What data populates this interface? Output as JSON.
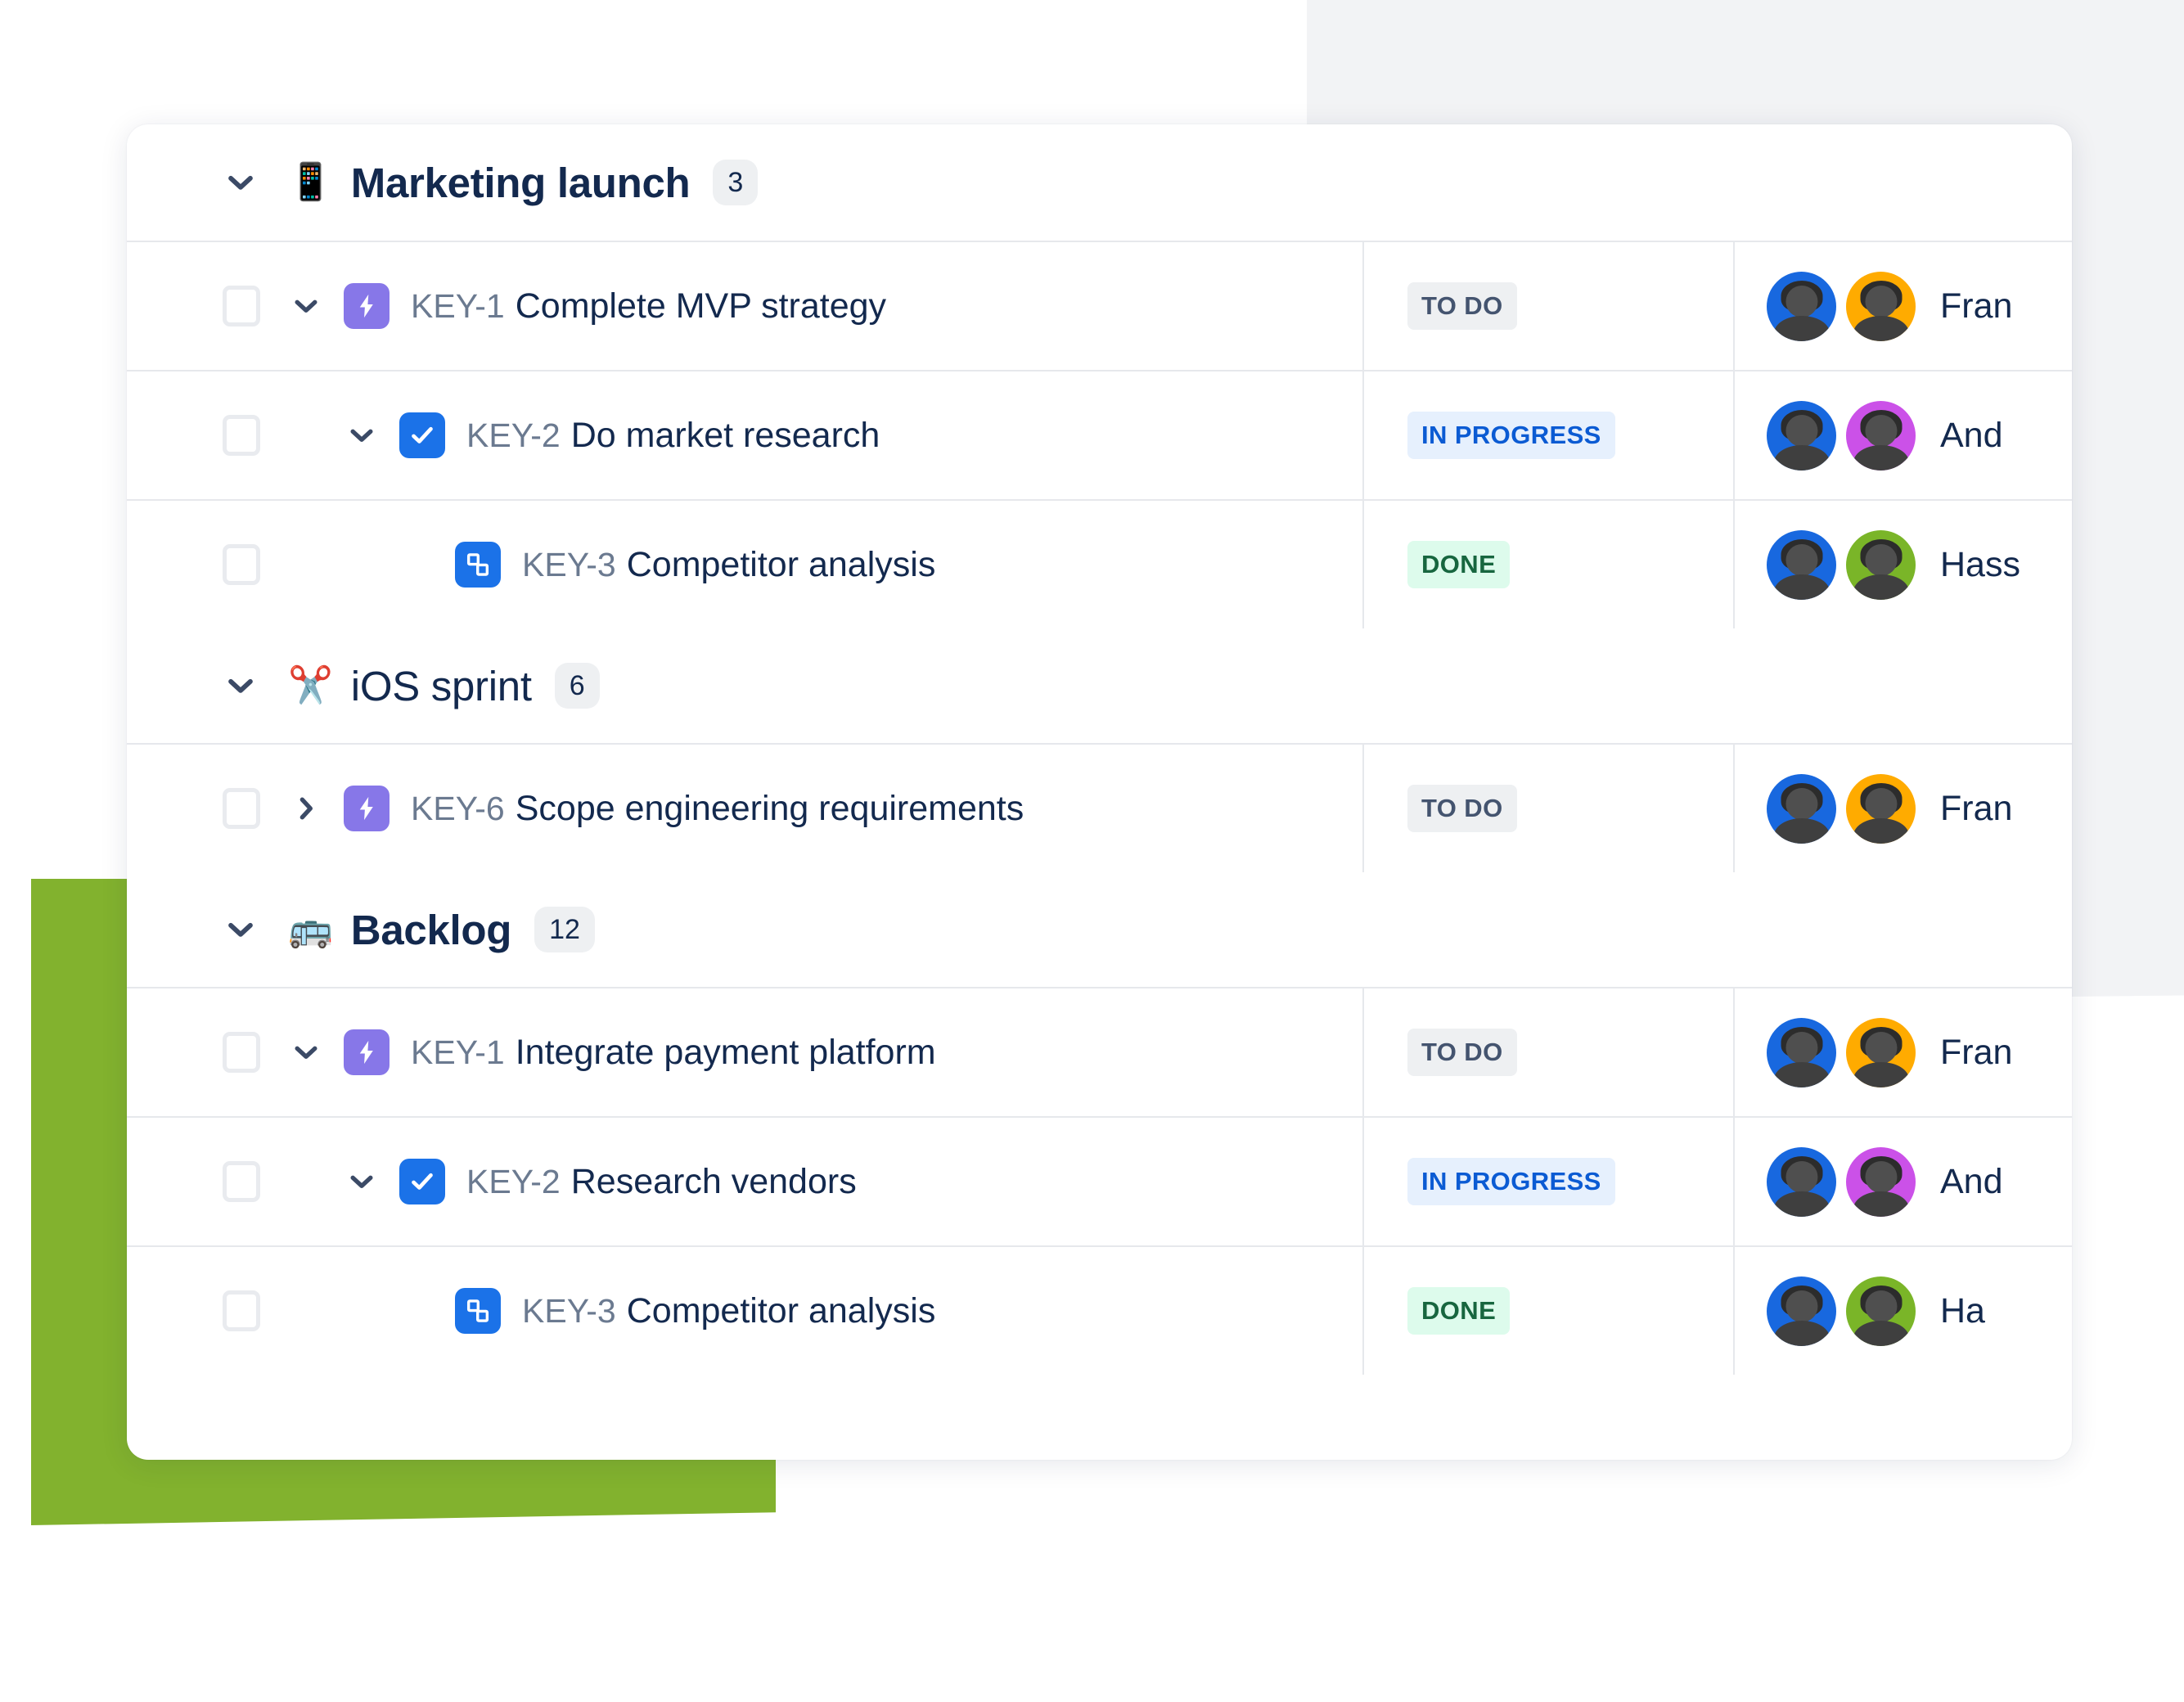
{
  "colors": {
    "green_block": "#82b22e",
    "gray_panel": "#f2f3f5",
    "epic_purple": "#8777e8",
    "task_blue": "#1b72e8",
    "text_navy": "#13294e",
    "key_gray": "#6b7a90",
    "todo_bg": "#eef0f2",
    "todo_fg": "#44546f",
    "inprogress_bg": "#e6f0fd",
    "inprogress_fg": "#0b5bd3",
    "done_bg": "#ddfbec",
    "done_fg": "#17663f"
  },
  "groups": [
    {
      "id": "marketing-launch",
      "emoji": "📱",
      "emoji_name": "mobile-phone-emoji",
      "title": "Marketing launch",
      "count": "3",
      "expanded": true,
      "chevron": "down",
      "bold": true,
      "rows": [
        {
          "indent": 1,
          "chevron": "down",
          "type": "epic",
          "type_icon_name": "epic-lightning-icon",
          "key": "KEY-1",
          "title": "Complete MVP strategy",
          "status": "TO DO",
          "status_kind": "todo",
          "assignee": "Fran",
          "avatars": [
            "#1868df",
            "#ffab00"
          ]
        },
        {
          "indent": 2,
          "chevron": "down",
          "type": "task",
          "type_icon_name": "task-checkmark-icon",
          "key": "KEY-2",
          "title": "Do market research",
          "status": "IN PROGRESS",
          "status_kind": "inprogress",
          "assignee": "And",
          "avatars": [
            "#1868df",
            "#cb51e8"
          ]
        },
        {
          "indent": 3,
          "chevron": "none",
          "type": "subtask",
          "type_icon_name": "subtask-blocks-icon",
          "key": "KEY-3",
          "title": "Competitor analysis",
          "status": "DONE",
          "status_kind": "done",
          "assignee": "Hass",
          "avatars": [
            "#1868df",
            "#7ab528"
          ]
        }
      ]
    },
    {
      "id": "ios-sprint",
      "emoji": "✂️",
      "emoji_name": "scissors-emoji",
      "title": "iOS sprint",
      "count": "6",
      "expanded": true,
      "chevron": "down",
      "bold": false,
      "rows": [
        {
          "indent": 1,
          "chevron": "right",
          "type": "epic",
          "type_icon_name": "epic-lightning-icon",
          "key": "KEY-6",
          "title": "Scope engineering requirements",
          "status": "TO DO",
          "status_kind": "todo",
          "assignee": "Fran",
          "avatars": [
            "#1868df",
            "#ffab00"
          ]
        }
      ]
    },
    {
      "id": "backlog",
      "emoji": "🚌",
      "emoji_name": "bus-emoji",
      "title": "Backlog",
      "count": "12",
      "expanded": true,
      "chevron": "down",
      "bold": true,
      "rows": [
        {
          "indent": 1,
          "chevron": "down",
          "type": "epic",
          "type_icon_name": "epic-lightning-icon",
          "key": "KEY-1",
          "title": "Integrate payment platform",
          "status": "TO DO",
          "status_kind": "todo",
          "assignee": "Fran",
          "avatars": [
            "#1868df",
            "#ffab00"
          ]
        },
        {
          "indent": 2,
          "chevron": "down",
          "type": "task",
          "type_icon_name": "task-checkmark-icon",
          "key": "KEY-2",
          "title": "Research vendors",
          "status": "IN PROGRESS",
          "status_kind": "inprogress",
          "assignee": "And",
          "avatars": [
            "#1868df",
            "#cb51e8"
          ]
        },
        {
          "indent": 3,
          "chevron": "none",
          "type": "subtask",
          "type_icon_name": "subtask-blocks-icon",
          "key": "KEY-3",
          "title": "Competitor analysis",
          "status": "DONE",
          "status_kind": "done",
          "assignee": "Ha",
          "avatars": [
            "#1868df",
            "#7ab528"
          ]
        }
      ]
    }
  ]
}
